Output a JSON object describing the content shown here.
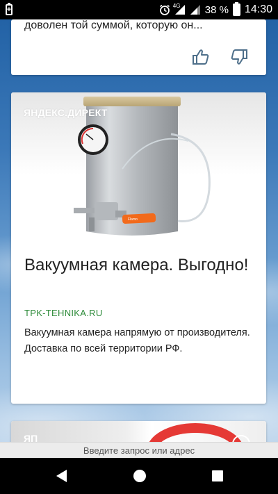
{
  "status_bar": {
    "network_label": "4G",
    "battery_percent": "38 %",
    "time": "14:30"
  },
  "feed": {
    "top_card": {
      "excerpt": "доволен той суммой, которую он...",
      "like_icon": "thumbs-up-icon",
      "dislike_icon": "thumbs-down-icon"
    },
    "ad_card": {
      "label": "ЯНДЕКС.ДИРЕКТ",
      "title": "Вакуумная камера. Выгодно!",
      "domain": "TPK-TEHNIKA.RU",
      "text": "Вакуумная камера напрямую от производителя. Доставка по всей территории РФ.",
      "product_sticker": "Flamo"
    },
    "next_card": {
      "label": "ЯП"
    }
  },
  "address_bar": {
    "placeholder": "Введите запрос или адрес"
  },
  "nav_bar": {
    "back_icon": "back-icon",
    "home_icon": "home-icon",
    "recents_icon": "recents-icon"
  },
  "colors": {
    "domain_green": "#2e8b3a",
    "orange_handle": "#f26a1b"
  }
}
